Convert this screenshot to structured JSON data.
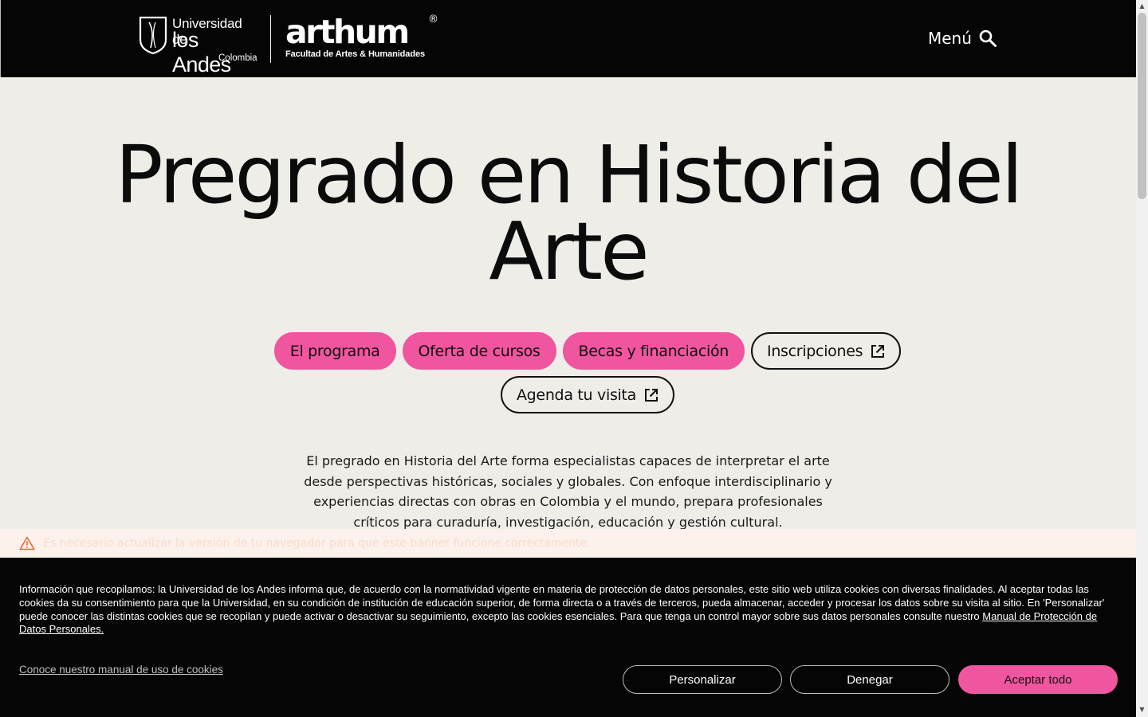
{
  "header": {
    "uniandes_line1": "Universidad de",
    "uniandes_line2": "los Andes",
    "uniandes_line3": "Colombia",
    "arthum_name": "arthum",
    "arthum_registered": "®",
    "arthum_subtitle": "Facultad de Artes & Humanidades",
    "menu_label": "Menú",
    "menu_icon": "search-icon"
  },
  "hero": {
    "title": "Pregrado en Historia del Arte"
  },
  "nav_pills": {
    "row1": [
      {
        "label": "El programa",
        "style": "filled"
      },
      {
        "label": "Oferta de cursos",
        "style": "filled"
      },
      {
        "label": "Becas y financiación",
        "style": "filled"
      },
      {
        "label": "Inscripciones",
        "style": "outline",
        "icon": "external-link-icon"
      }
    ],
    "row2": [
      {
        "label": "Agenda tu visita",
        "style": "outline",
        "icon": "external-link-icon"
      }
    ]
  },
  "description": "El pregrado en Historia del Arte forma especialistas capaces de interpretar el arte desde perspectivas históricas, sociales y globales. Con enfoque interdisciplinario y experiencias directas con obras en Colombia y el mundo, prepara profesionales críticos para curaduría, investigación, educación y gestión cultural.",
  "warning": {
    "icon": "warning-triangle-icon",
    "text": "Es necesario actualizar la versión de tu navegador para que este banner funcione correctamente."
  },
  "cookie_banner": {
    "text": "Información que recopilamos: la Universidad de los Andes informa que, de acuerdo con la normatividad vigente en materia de protección de datos personales, este sitio web utiliza cookies con diversas finalidades. Al aceptar todas las cookies da su consentimiento para que la Universidad, en su condición de institución de educación superior, de forma directa o a través de terceros, pueda almacenar, acceder y procesar los datos sobre su visita al sitio. En 'Personalizar' puede conocer las distintas cookies que se recopilan y puede activar o desactivar su seguimiento, excepto las cookies esenciales. Para que tenga un control mayor sobre sus datos personales consulte nuestro",
    "link_text": "Manual de Protección de Datos Personales.",
    "manual_link": "Conoce nuestro manual de uso de cookies",
    "btn_personalizar": "Personalizar",
    "btn_denegar": "Denegar",
    "btn_aceptar": "Aceptar todo"
  },
  "colors": {
    "accent": "#f0559f",
    "header_bg": "#050505",
    "page_bg": "#efede8",
    "warning_bg": "#fcf1eb"
  }
}
